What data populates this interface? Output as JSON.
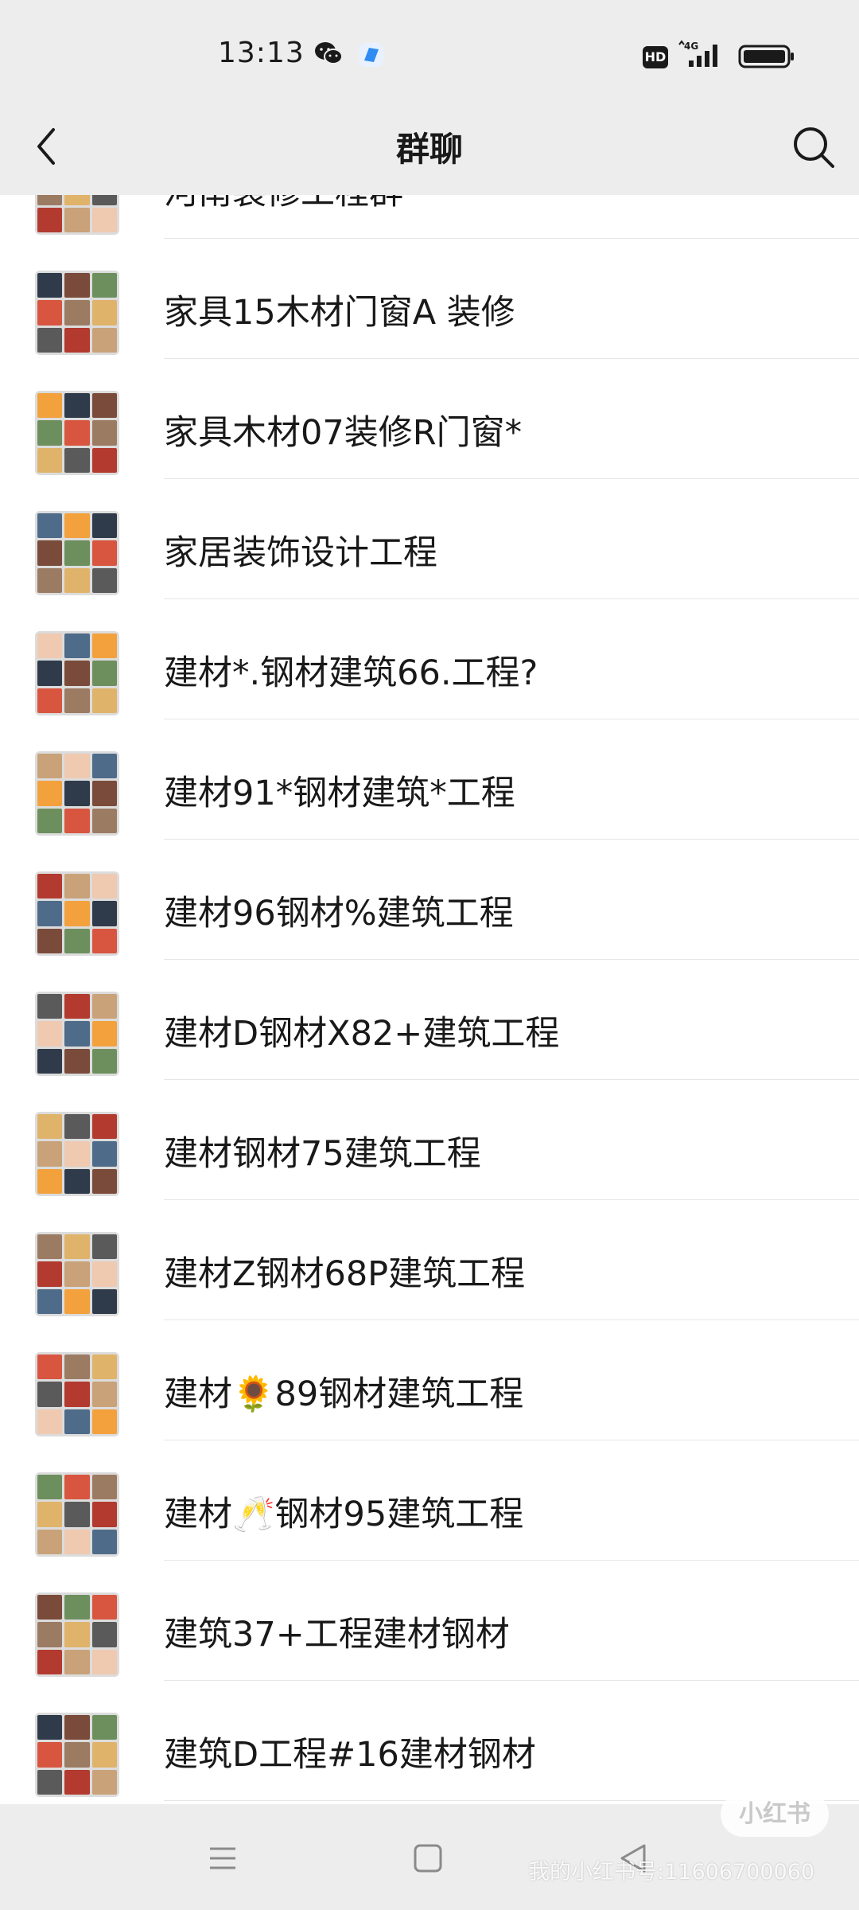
{
  "status_bar": {
    "time": "13:13",
    "hd": "HD",
    "network": "4G"
  },
  "header": {
    "title": "群聊"
  },
  "groups": [
    {
      "name": "河南装修工程群"
    },
    {
      "name": "家具15木材门窗A 装修"
    },
    {
      "name": "家具木材07装修R门窗*"
    },
    {
      "name": "家居装饰设计工程"
    },
    {
      "name": "建材*.钢材建筑66.工程?"
    },
    {
      "name": "建材91*钢材建筑*工程"
    },
    {
      "name": "建材96钢材%建筑工程"
    },
    {
      "name": "建材D钢材X82+建筑工程"
    },
    {
      "name": "建材钢材75建筑工程"
    },
    {
      "name": "建材Z钢材68P建筑工程"
    },
    {
      "name": "建材🌻89钢材建筑工程"
    },
    {
      "name": "建材🥂钢材95建筑工程"
    },
    {
      "name": "建筑37+工程建材钢材"
    },
    {
      "name": "建筑D工程#16建材钢材"
    }
  ],
  "watermark": {
    "logo": "小红书",
    "text": "我的小红书号:11606700060"
  },
  "colors": {
    "background": "#ededed",
    "list_background": "#ffffff",
    "text": "#191919",
    "divider": "#e6e6e6"
  }
}
